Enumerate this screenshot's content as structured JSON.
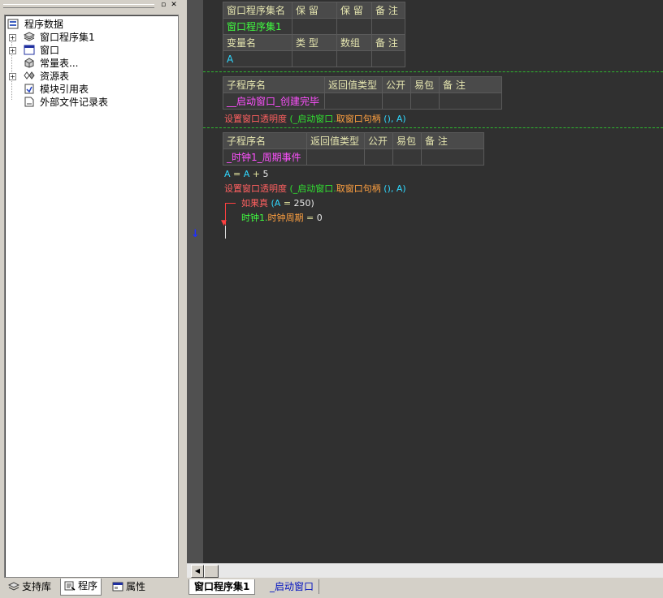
{
  "tree": {
    "root_label": "程序数据",
    "items": [
      {
        "label": "窗口程序集1",
        "expandable": true,
        "icon": "layers-icon"
      },
      {
        "label": "窗口",
        "expandable": true,
        "icon": "window-icon"
      },
      {
        "label": "常量表...",
        "expandable": false,
        "icon": "cube-icon"
      },
      {
        "label": "资源表",
        "expandable": true,
        "icon": "resource-icon"
      },
      {
        "label": "模块引用表",
        "expandable": false,
        "icon": "module-icon"
      },
      {
        "label": "外部文件记录表",
        "expandable": false,
        "icon": "file-icon"
      }
    ]
  },
  "left_tabs": [
    {
      "label": "支持库",
      "icon": "library-icon"
    },
    {
      "label": "程序",
      "icon": "program-icon"
    },
    {
      "label": "属性",
      "icon": "property-icon"
    }
  ],
  "assembly_table": {
    "headers": [
      "窗口程序集名",
      "保 留",
      "保 留",
      "备 注"
    ],
    "row": [
      "窗口程序集1",
      "",
      "",
      ""
    ],
    "var_headers": [
      "变量名",
      "类 型",
      "数组",
      "备 注"
    ],
    "var_row": [
      "A",
      "",
      "",
      ""
    ]
  },
  "sub1": {
    "headers": [
      "子程序名",
      "返回值类型",
      "公开",
      "易包",
      "备 注"
    ],
    "name": "__启动窗口_创建完毕",
    "code_func": "设置窗口透明度",
    "code_args": "(_启动窗口.",
    "code_method": "取窗口句柄",
    "code_tail": "(), A)"
  },
  "sub2": {
    "headers": [
      "子程序名",
      "返回值类型",
      "公开",
      "易包",
      "备 注"
    ],
    "name": "_时钟1_周期事件",
    "line1": {
      "a": "A",
      "eq": "=",
      "b": "A",
      "op": "+",
      "num": "5"
    },
    "line2_func": "设置窗口透明度",
    "line2_args": "(_启动窗口.",
    "line2_method": "取窗口句柄",
    "line2_tail": "(), A)",
    "if_kw": "如果真",
    "if_cond_open": "(",
    "if_var": "A",
    "if_eq": "=",
    "if_val": "250)",
    "assign_obj": "时钟1.",
    "assign_prop": "时钟周期",
    "assign_eq": "=",
    "assign_val": "0"
  },
  "doc_tabs": [
    "窗口程序集1",
    "_启动窗口"
  ]
}
